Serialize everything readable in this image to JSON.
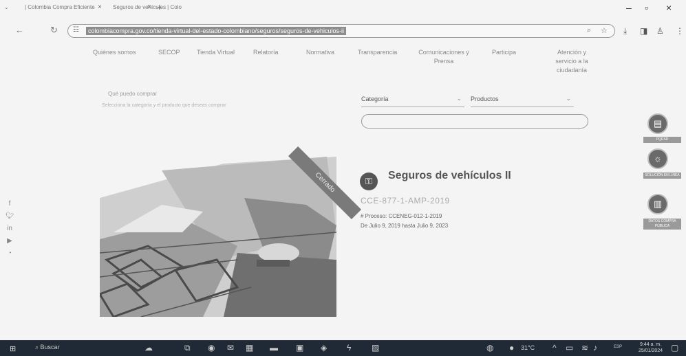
{
  "browser": {
    "tabs": [
      {
        "label": "| Colombia Compra Eficiente"
      },
      {
        "label": "Seguros de vehículos | Colo"
      }
    ],
    "url": "colombiacompra.gov.co/tienda-virtual-del-estado-colombiano/seguros/seguros-de-vehiculos-ii"
  },
  "nav": {
    "items": [
      {
        "label": "Quiénes somos"
      },
      {
        "label": "SECOP"
      },
      {
        "label": "Tienda Virtual"
      },
      {
        "label": "Relatoría"
      },
      {
        "label": "Normativa"
      },
      {
        "label": "Transparencia"
      },
      {
        "label": "Comunicaciones y Prensa"
      },
      {
        "label": "Participa"
      },
      {
        "label": "Atención y servicio a la ciudadanía"
      }
    ]
  },
  "intro": {
    "question": "Qué puedo comprar",
    "subtitle": "Selecciona la categoría y el producto que deseas comprar"
  },
  "filters": {
    "category_label": "Categoría",
    "product_label": "Productos"
  },
  "product": {
    "status": "Cerrado",
    "title": "Seguros de vehículos II",
    "code": "CCE-877-1-AMP-2019",
    "process": "# Proceso: CCENEG-012-1-2019",
    "dates": "De Julio 9, 2019 hasta Julio 9, 2023"
  },
  "sidebar": {
    "labels": [
      "PQRSD",
      "SOLUCIÓN EN LÍNEA",
      "DATOS COMPRA PÚBLICA"
    ]
  },
  "taskbar": {
    "search": "Buscar",
    "temperature": "31°C",
    "lang": "ESP",
    "time": "9:44 a. m.",
    "date": "25/01/2024"
  }
}
